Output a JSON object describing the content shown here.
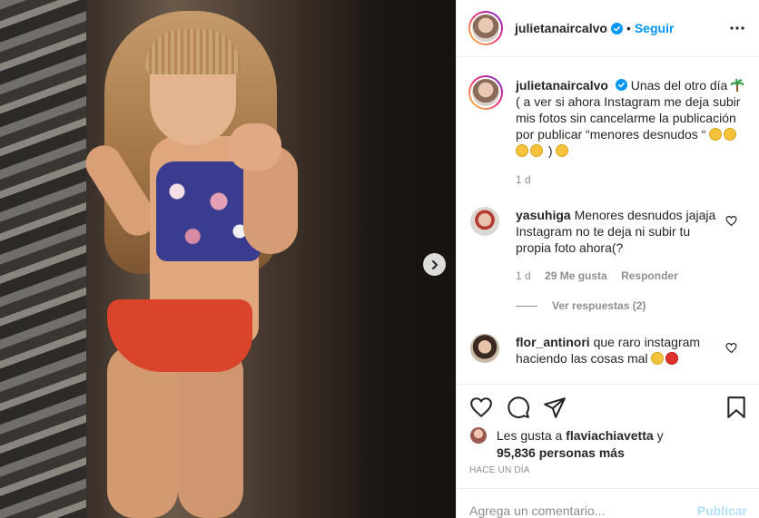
{
  "post": {
    "username": "julietanaircalvo",
    "follow_label": "Seguir",
    "separator": "•"
  },
  "caption": {
    "username": "julietanaircalvo",
    "text_1": "Unas del otro día",
    "text_2": "( a ver si ahora Instagram me deja subir mis fotos sin cancelarme la publicación por publicar “menores desnudos “",
    "text_3": ")",
    "time": "1 d"
  },
  "comments": [
    {
      "username": "yasuhiga",
      "text": "Menores desnudos jajaja Instagram no te deja ni subir tu propia foto ahora(?",
      "time": "1 d",
      "likes": "29 Me gusta",
      "reply_label": "Responder",
      "view_replies": "Ver respuestas (2)"
    },
    {
      "username": "flor_antinori",
      "text": "que raro instagram haciendo las cosas mal"
    }
  ],
  "likes": {
    "prefix": "Les gusta a",
    "user": "flaviachiavetta",
    "conj": "y",
    "count": "95,836 personas más"
  },
  "time_ago": "HACE UN DÍA",
  "add_comment": {
    "placeholder": "Agrega un comentario...",
    "publish_label": "Publicar"
  },
  "colors": {
    "accent": "#0095f6",
    "publish_disabled": "#b2dffc",
    "muted": "#8e8e8e",
    "text": "#262626"
  },
  "icons": [
    "verified-badge-icon",
    "more-options-icon",
    "next-arrow-icon",
    "heart-icon",
    "comment-icon",
    "share-icon",
    "bookmark-icon"
  ]
}
